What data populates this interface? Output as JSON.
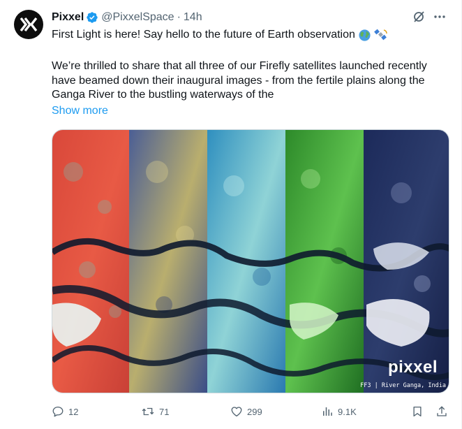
{
  "author": {
    "name": "Pixxel",
    "handle": "@PixxelSpace",
    "separator": "·",
    "time": "14h",
    "avatar_icon": "pixxel-logo-icon",
    "verified_icon": "verified-badge-icon"
  },
  "tweet": {
    "line1": "First Light is here! Say hello to the future of Earth observation",
    "line1_emojis": [
      "globe-icon",
      "satellite-icon"
    ],
    "paragraph": "We’re thrilled to share that all three of our Firefly satellites launched recently have beamed down their inaugural images - from the fertile plains along the Ganga River to the bustling waterways of the",
    "show_more": "Show more"
  },
  "media": {
    "watermark": "pixxel",
    "caption": "FF3 | River Ganga, India",
    "strip_colors": [
      "#d9483a",
      "#5a6fa6",
      "#3fa7c9",
      "#3c9d36",
      "#1a2550"
    ]
  },
  "actions": {
    "replies": "12",
    "reposts": "71",
    "likes": "299",
    "views": "9.1K",
    "reply_icon": "reply-icon",
    "repost_icon": "repost-icon",
    "like_icon": "heart-icon",
    "views_icon": "views-bar-chart-icon",
    "bookmark_icon": "bookmark-icon",
    "share_icon": "share-icon"
  },
  "colors": {
    "accent": "#1d9bf0",
    "muted": "#536471",
    "text": "#0f1419",
    "verified": "#1d9bf0"
  }
}
